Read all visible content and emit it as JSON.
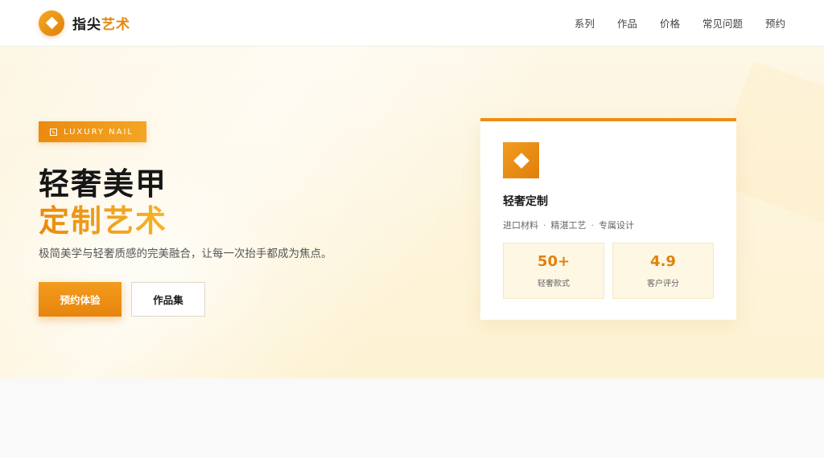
{
  "header": {
    "logo_text_dark": "指尖",
    "logo_text_accent": "艺术",
    "logo_icon": "diamond-icon",
    "nav": [
      "系列",
      "作品",
      "价格",
      "常见问题",
      "预约"
    ]
  },
  "hero": {
    "badge": "LUXURY NAIL",
    "title_line1": "轻奢美甲",
    "title_line2": "定制艺术",
    "subtitle": "极简美学与轻奢质感的完美融合，让每一次抬手都成为焦点。",
    "primary_button": "预约体验",
    "secondary_button": "作品集"
  },
  "card": {
    "icon": "diamond-icon",
    "title": "轻奢定制",
    "features": [
      "进口材料",
      "精湛工艺",
      "专属设计"
    ],
    "separator": "·",
    "stats": [
      {
        "value": "50+",
        "label": "轻奢款式"
      },
      {
        "value": "4.9",
        "label": "客户评分"
      }
    ]
  },
  "colors": {
    "accent": "#ED8D10",
    "accent_light": "#F5B42A",
    "hero_bg": "#FDF4DA"
  }
}
